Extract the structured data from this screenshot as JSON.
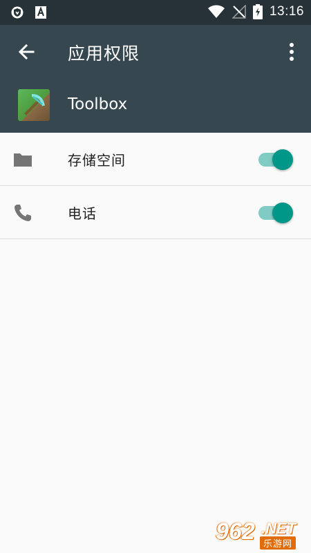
{
  "status_bar": {
    "time": "13:16",
    "icons": [
      "vpn-shield-icon",
      "font-a-icon",
      "wifi-icon",
      "no-signal-icon",
      "battery-charging-icon"
    ]
  },
  "toolbar": {
    "title": "应用权限",
    "back_icon": "arrow-back-icon",
    "more_icon": "more-vert-icon"
  },
  "app": {
    "name": "Toolbox",
    "icon": "pickaxe-app-icon"
  },
  "permissions": [
    {
      "label": "存储空间",
      "icon": "folder-icon",
      "enabled": true
    },
    {
      "label": "电话",
      "icon": "phone-icon",
      "enabled": true
    }
  ],
  "watermark": {
    "number": "962",
    "suffix": ".NET",
    "site": "乐游网"
  },
  "colors": {
    "status_bar": "#263238",
    "toolbar": "#37474f",
    "accent": "#009688",
    "accent_track": "#80cbc4",
    "background": "#fafafa"
  }
}
